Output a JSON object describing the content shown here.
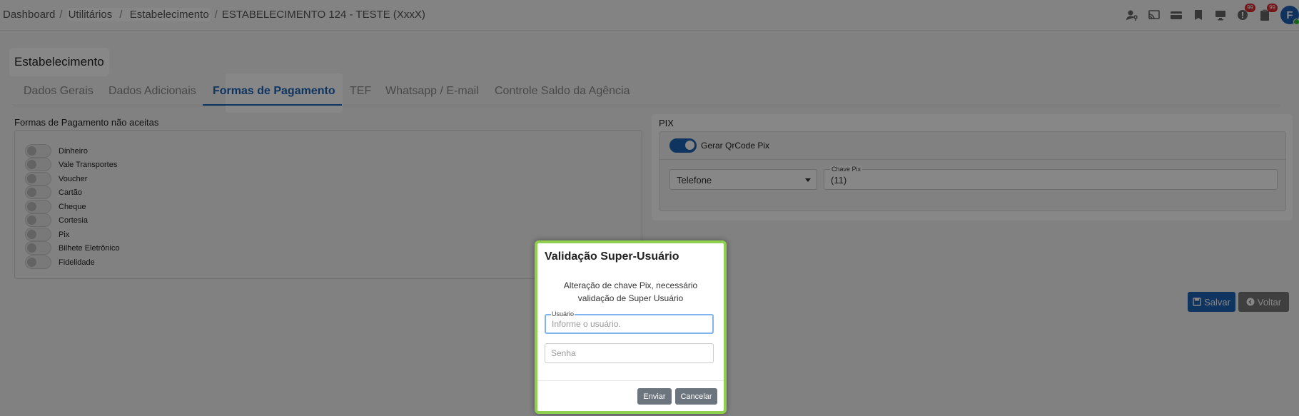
{
  "breadcrumb": {
    "items": [
      "Dashboard",
      "Utilitários",
      "Estabelecimento",
      "ESTABELECIMENTO 124 - TESTE (XxxX)"
    ],
    "separator": "/"
  },
  "header": {
    "icons": [
      "user-key-icon",
      "cast-icon",
      "card-icon",
      "bookmark-icon",
      "monitor-icon",
      "alert-icon",
      "clipboard-icon"
    ],
    "badge_alert": "99",
    "badge_clipboard": "99",
    "avatar_letter": "F"
  },
  "page": {
    "title": "Estabelecimento",
    "tabs": [
      "Dados Gerais",
      "Dados Adicionais",
      "Formas de Pagamento",
      "TEF",
      "Whatsapp / E-mail",
      "Controle Saldo da Agência"
    ],
    "active_tab": "Formas de Pagamento"
  },
  "payment": {
    "section_title": "Formas de Pagamento não aceitas",
    "methods": [
      "Dinheiro",
      "Vale Transportes",
      "Voucher",
      "Cartão",
      "Cheque",
      "Cortesia",
      "Pix",
      "Bilhete Eletrônico",
      "Fidelidade"
    ]
  },
  "pix": {
    "title": "PIX",
    "toggle_label": "Gerar QrCode Pix",
    "toggle_on": true,
    "key_type": "Telefone",
    "key_label": "Chave Pix",
    "key_value": "(11)"
  },
  "actions": {
    "save": "Salvar",
    "back": "Voltar"
  },
  "modal": {
    "title": "Validação Super-Usuário",
    "message_line1": "Alteração de chave Pix, necessário",
    "message_line2": "validação de Super Usuário",
    "user_label": "Usuário",
    "user_placeholder": "Informe o usuário.",
    "password_placeholder": "Senha",
    "submit": "Enviar",
    "cancel": "Cancelar"
  },
  "colors": {
    "primary": "#1d63b6",
    "modal_border": "#8fd14f",
    "badge": "#d9262c"
  }
}
